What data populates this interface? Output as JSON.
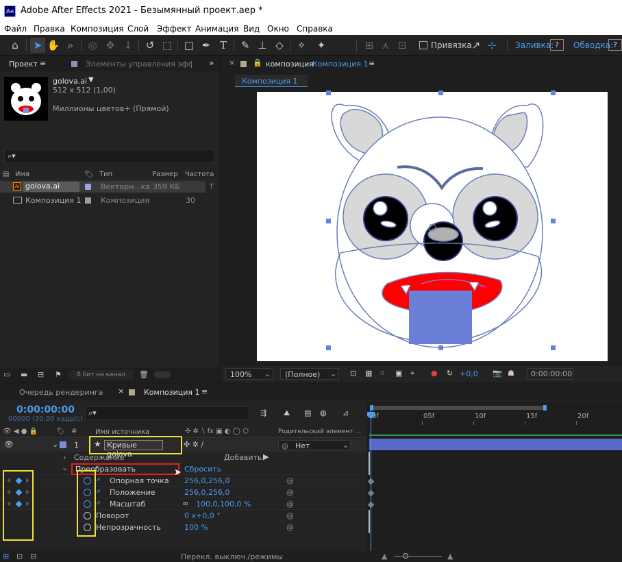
{
  "window": {
    "title": "Adobe After Effects 2021 - Безымянный проект.aep *",
    "app_icon": "Ae"
  },
  "menu": [
    "Файл",
    "Правка",
    "Композиция",
    "Слой",
    "Эффект",
    "Анимация",
    "Вид",
    "Окно",
    "Справка"
  ],
  "toolbar": {
    "snapping_label": "Привязка",
    "fill_label": "Заливка:",
    "fill_value": "?",
    "stroke_label": "Обводка:",
    "stroke_value": "?"
  },
  "project_panel": {
    "tab_project": "Проект",
    "tab_effects": "Элементы управления эффект",
    "item_name": "golova.ai",
    "item_dims": "512 x 512 (1,00)",
    "item_colors": "Миллионы цветов+ (Прямой)",
    "search_placeholder": "",
    "columns": {
      "name": "Имя",
      "type": "Тип",
      "size": "Размер",
      "rate": "Частота"
    },
    "rows": [
      {
        "name": "golova.ai",
        "type": "Векторн...ка",
        "size": "359 КБ",
        "rate": "",
        "selected": true
      },
      {
        "name": "Композиция 1",
        "type": "Композиция",
        "size": "",
        "rate": "30",
        "selected": false
      }
    ],
    "bit_depth": "8 бит на канал"
  },
  "comp_panel": {
    "tab_prefix": "композиция",
    "tab_name": "Композиция 1",
    "breadcrumb": "Композиция 1",
    "zoom": "100%",
    "resolution": "(Полное)",
    "exposure": "+0,0",
    "timecode": "0:00:00:00"
  },
  "timeline_panel": {
    "tab_render": "Очередь рендеринга",
    "tab_comp": "Композиция 1",
    "current_time": "0:00:00:00",
    "frame_info": "00000 (30.00 кадр/с)",
    "col_source": "Имя источника",
    "col_parent": "Родительский элемент ...",
    "ruler_labels": [
      "0f",
      "05f",
      "10f",
      "15f",
      "20f"
    ],
    "layer": {
      "index": "1",
      "name": "Кривые golova",
      "parent": "Нет"
    },
    "contents_label": "Содержание",
    "add_label": "Добавить:",
    "transform_label": "Преобразовать",
    "reset_label": "Сбросить",
    "properties": [
      {
        "name": "Опорная точка",
        "value": "256,0,256,0",
        "keyframed": true
      },
      {
        "name": "Положение",
        "value": "256,0,256,0",
        "keyframed": true
      },
      {
        "name": "Масштаб",
        "value": "100,0,100,0 %",
        "keyframed": true
      },
      {
        "name": "Поворот",
        "value": "0 x+0,0 °",
        "keyframed": false
      },
      {
        "name": "Непрозрачность",
        "value": "100 %",
        "keyframed": false
      }
    ],
    "toggle_label": "Перекл. выключ./режимы"
  },
  "colors": {
    "accent_blue": "#4a9cf0",
    "highlight_yellow": "#f0e03a",
    "highlight_red": "#e02020",
    "layer_bar": "#5a6ac8",
    "shape_stroke": "#6a7fb8",
    "mouth_red": "#ff0000",
    "tongue": "#6a7fd8"
  }
}
